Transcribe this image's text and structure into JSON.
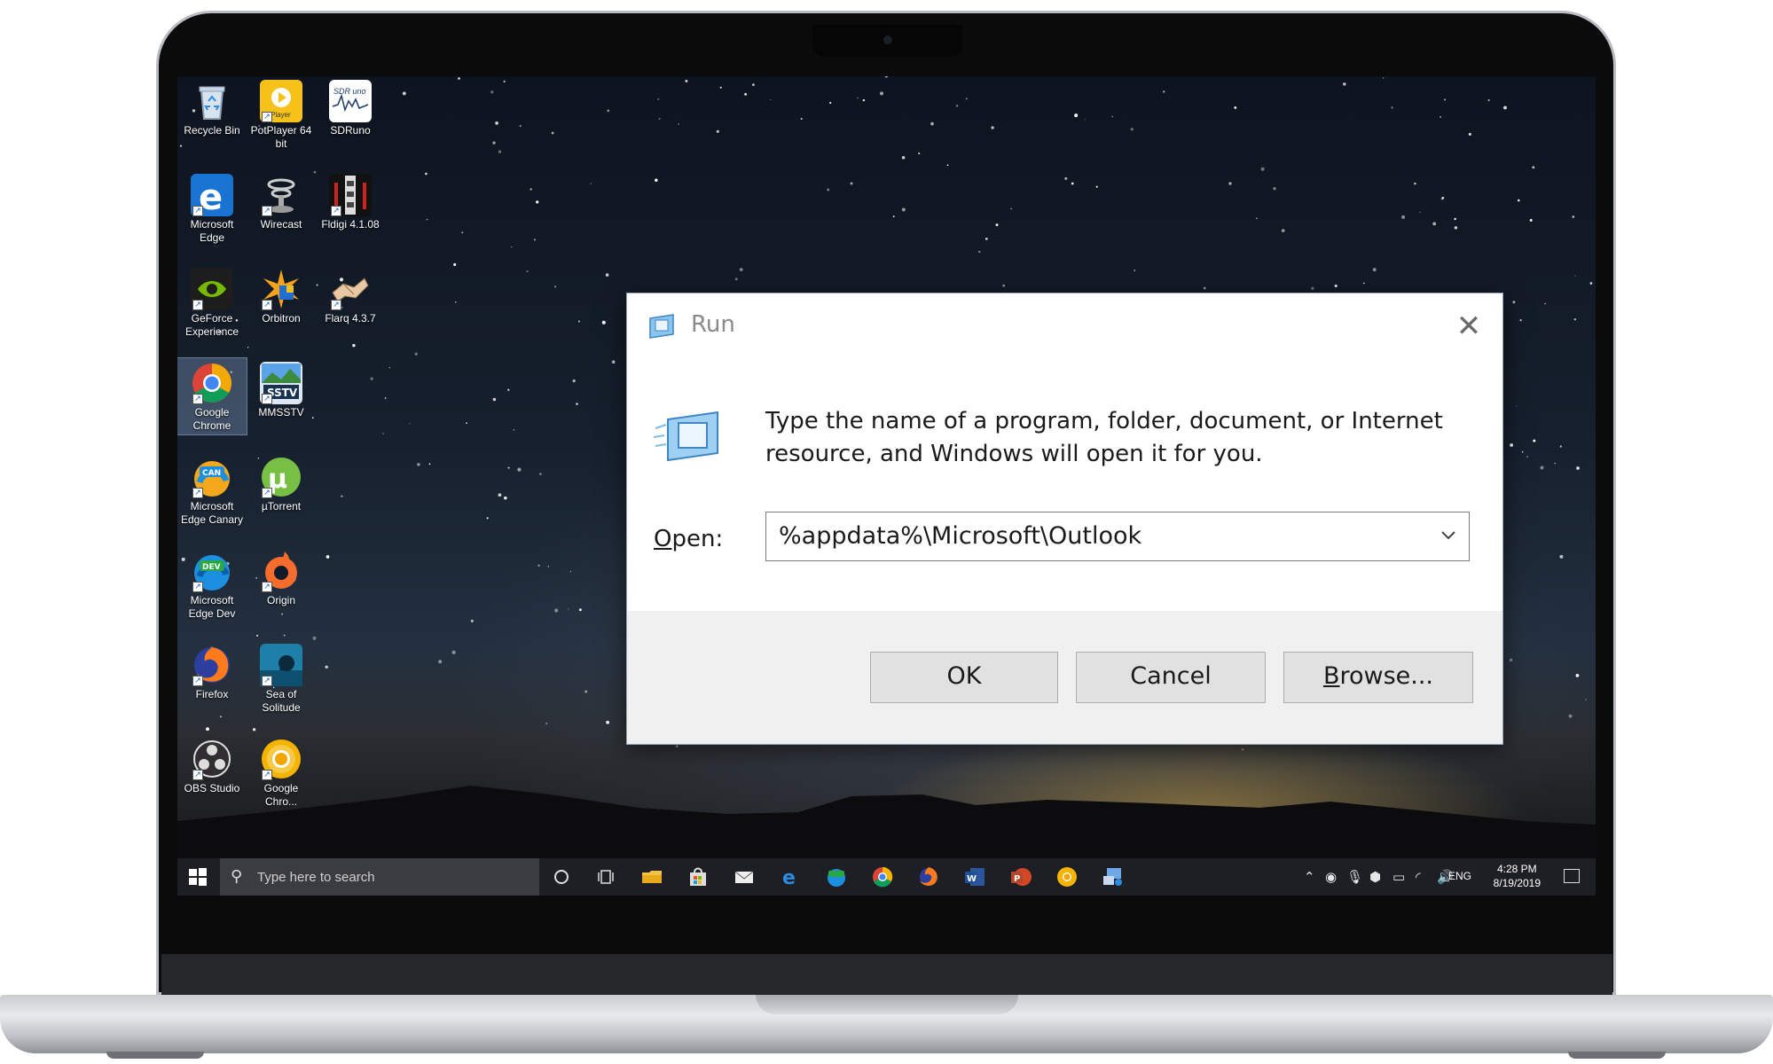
{
  "desktop": {
    "icons": [
      {
        "label": "Recycle Bin",
        "icon": "recycle-bin-icon"
      },
      {
        "label": "PotPlayer 64 bit",
        "icon": "potplayer-icon",
        "badge": "Player"
      },
      {
        "label": "SDRuno",
        "icon": "sdruno-icon",
        "badge": "SDR uno"
      },
      {
        "label": "Microsoft Edge",
        "icon": "edge-icon"
      },
      {
        "label": "Wirecast",
        "icon": "wirecast-icon"
      },
      {
        "label": "Fldigi 4.1.08",
        "icon": "fldigi-icon"
      },
      {
        "label": "GeForce Experience",
        "icon": "geforce-icon"
      },
      {
        "label": "Orbitron",
        "icon": "orbitron-icon"
      },
      {
        "label": "Flarq 4.3.7",
        "icon": "flarq-icon"
      },
      {
        "label": "Google Chrome",
        "icon": "chrome-icon"
      },
      {
        "label": "MMSSTV",
        "icon": "mmsstv-icon",
        "badge": "SSTV"
      },
      {
        "label": "Microsoft Edge Canary",
        "icon": "edge-canary-icon",
        "badge": "CAN"
      },
      {
        "label": "µTorrent",
        "icon": "utorrent-icon"
      },
      {
        "label": "Microsoft Edge Dev",
        "icon": "edge-dev-icon",
        "badge": "DEV"
      },
      {
        "label": "Origin",
        "icon": "origin-icon"
      },
      {
        "label": "Firefox",
        "icon": "firefox-icon"
      },
      {
        "label": "Sea of Solitude",
        "icon": "sea-of-solitude-icon"
      },
      {
        "label": "OBS Studio",
        "icon": "obs-icon"
      },
      {
        "label": "Google Chro...",
        "icon": "chrome-canary-icon"
      }
    ]
  },
  "taskbar": {
    "search_placeholder": "Type here to search",
    "apps": [
      "cortana-icon",
      "task-view-icon",
      "file-explorer-icon",
      "store-icon",
      "mail-icon",
      "edge-icon",
      "edge-dev-icon",
      "chrome-icon",
      "firefox-icon",
      "word-icon",
      "powerpoint-icon",
      "chrome-canary-icon",
      "network-tool-icon"
    ],
    "language": "ENG",
    "time": "4:28 PM",
    "date": "8/19/2019"
  },
  "run_dialog": {
    "title": "Run",
    "description": "Type the name of a program, folder, document, or Internet resource, and Windows will open it for you.",
    "open_label_accel": "O",
    "open_label_rest": "pen:",
    "open_value": "%appdata%\\Microsoft\\Outlook",
    "ok_label": "OK",
    "cancel_label": "Cancel",
    "browse_accel": "B",
    "browse_rest": "rowse...",
    "close_glyph": "✕"
  },
  "colors": {
    "accent": "#1e64c8",
    "dialog_bg": "#f0f0f0",
    "button_bg": "#e1e1e1",
    "taskbar_bg": "#1e1f24"
  }
}
